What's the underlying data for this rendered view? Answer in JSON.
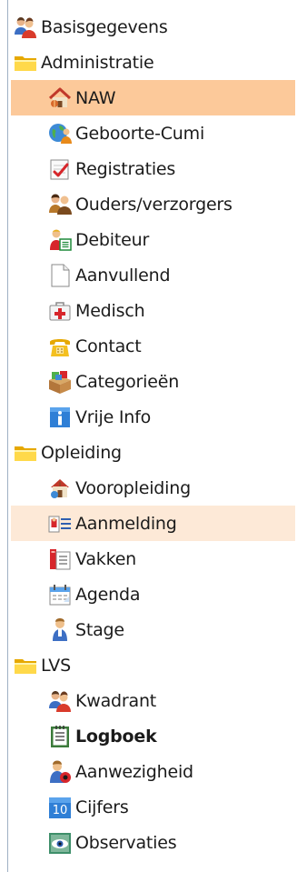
{
  "tree": {
    "items": [
      {
        "label": "Basisgegevens",
        "icon": "users-icon",
        "level": 0
      },
      {
        "label": "Administratie",
        "icon": "folder-icon",
        "level": 0
      },
      {
        "label": "NAW",
        "icon": "house-icon",
        "level": 1,
        "state": "selected"
      },
      {
        "label": "Geboorte-Cumi",
        "icon": "globe-person-icon",
        "level": 1
      },
      {
        "label": "Registraties",
        "icon": "checklist-icon",
        "level": 1
      },
      {
        "label": "Ouders/verzorgers",
        "icon": "parents-icon",
        "level": 1
      },
      {
        "label": "Debiteur",
        "icon": "debtor-icon",
        "level": 1
      },
      {
        "label": "Aanvullend",
        "icon": "blank-page-icon",
        "level": 1
      },
      {
        "label": "Medisch",
        "icon": "first-aid-icon",
        "level": 1
      },
      {
        "label": "Contact",
        "icon": "telephone-icon",
        "level": 1
      },
      {
        "label": "Categorieën",
        "icon": "boxes-icon",
        "level": 1
      },
      {
        "label": "Vrije Info",
        "icon": "info-icon",
        "level": 1
      },
      {
        "label": "Opleiding",
        "icon": "folder-icon",
        "level": 0
      },
      {
        "label": "Vooropleiding",
        "icon": "school-house-icon",
        "level": 1
      },
      {
        "label": "Aanmelding",
        "icon": "registration-form-icon",
        "level": 1,
        "state": "hovered"
      },
      {
        "label": "Vakken",
        "icon": "books-icon",
        "level": 1
      },
      {
        "label": "Agenda",
        "icon": "calendar-icon",
        "level": 1
      },
      {
        "label": "Stage",
        "icon": "person-icon",
        "level": 1
      },
      {
        "label": "LVS",
        "icon": "folder-icon",
        "level": 0
      },
      {
        "label": "Kwadrant",
        "icon": "users-icon",
        "level": 1
      },
      {
        "label": "Logboek",
        "icon": "notebook-icon",
        "level": 1,
        "bold": true
      },
      {
        "label": "Aanwezigheid",
        "icon": "attendance-icon",
        "level": 1
      },
      {
        "label": "Cijfers",
        "icon": "grade-icon",
        "level": 1,
        "badge": "10"
      },
      {
        "label": "Observaties",
        "icon": "observation-icon",
        "level": 1
      }
    ]
  },
  "colors": {
    "selected_bg": "#fcc99a",
    "hovered_bg": "#fde9d7",
    "text": "#1b1b1b",
    "rule": "#9fb0c4",
    "folder": "#f5c518"
  }
}
